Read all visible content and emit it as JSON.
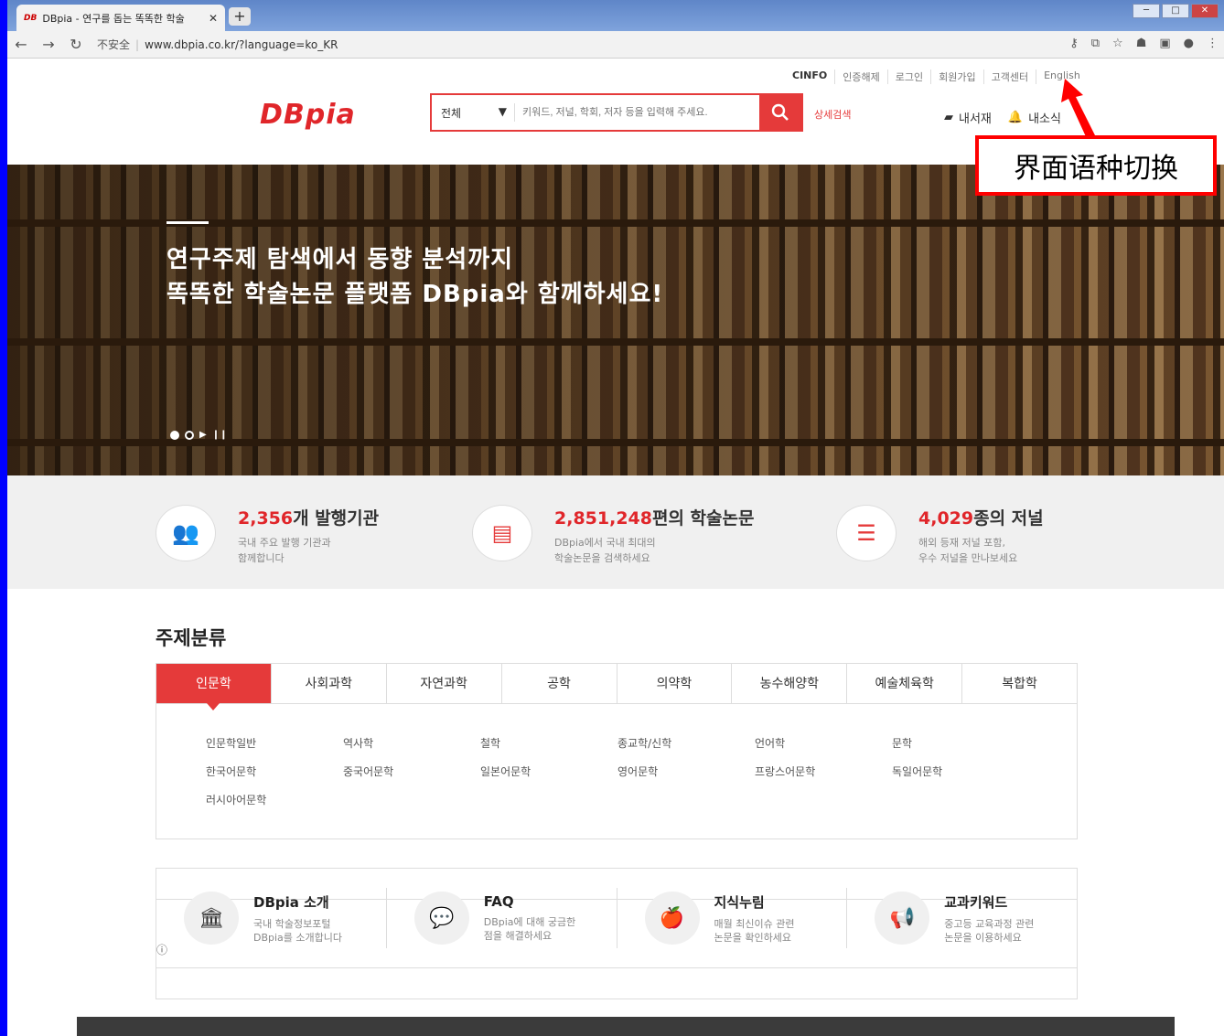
{
  "browser": {
    "tab_title": "DBpia - 연구를 돕는 똑똑한 학술",
    "tab_favicon": "DB",
    "insecure_label": "不安全",
    "url": "www.dbpia.co.kr/?language=ko_KR"
  },
  "header": {
    "toplinks": [
      "CINFO",
      "인증해제",
      "로그인",
      "회원가입",
      "고객센터",
      "English"
    ],
    "logo": "DBpia",
    "search_scope": "전체",
    "search_placeholder": "키워드, 저널, 학회, 저자 등을 입력해 주세요.",
    "advanced_search": "상세검색",
    "my_library": "내서재",
    "my_news": "내소식"
  },
  "annotation": "界面语种切换",
  "hero": {
    "line1": "연구주제 탐색에서 동향 분석까지",
    "line2": "똑똑한 학술논문 플랫폼 DBpia와 함께하세요!"
  },
  "stats": [
    {
      "num": "2,356",
      "unit": "개 발행기관",
      "desc1": "국내 주요 발행 기관과",
      "desc2": "함께합니다"
    },
    {
      "num": "2,851,248",
      "unit": "편의 학술논문",
      "desc1": "DBpia에서 국내 최대의",
      "desc2": "학술논문을 검색하세요"
    },
    {
      "num": "4,029",
      "unit": "종의 저널",
      "desc1": "해외 등재 저널 포함,",
      "desc2": "우수 저널을 만나보세요"
    }
  ],
  "subjects": {
    "title": "주제분류",
    "tabs": [
      "인문학",
      "사회과학",
      "자연과학",
      "공학",
      "의약학",
      "농수해양학",
      "예술체육학",
      "복합학"
    ],
    "items": [
      "인문학일반",
      "역사학",
      "철학",
      "종교학/신학",
      "언어학",
      "문학",
      "한국어문학",
      "중국어문학",
      "일본어문학",
      "영어문학",
      "프랑스어문학",
      "독일어문학",
      "러시아어문학"
    ]
  },
  "info": [
    {
      "title": "DBpia 소개",
      "d1": "국내 학술정보포털",
      "d2": "DBpia를 소개합니다"
    },
    {
      "title": "FAQ",
      "d1": "DBpia에 대해 궁금한",
      "d2": "점을 해결하세요"
    },
    {
      "title": "지식누림",
      "d1": "매월 최신이슈 관련",
      "d2": "논문을 확인하세요"
    },
    {
      "title": "교과키워드",
      "d1": "중고등 교육과정 관련",
      "d2": "논문을 이용하세요"
    }
  ],
  "colors": {
    "accent": "#e53a3a",
    "annotation_border": "#ff0000"
  }
}
